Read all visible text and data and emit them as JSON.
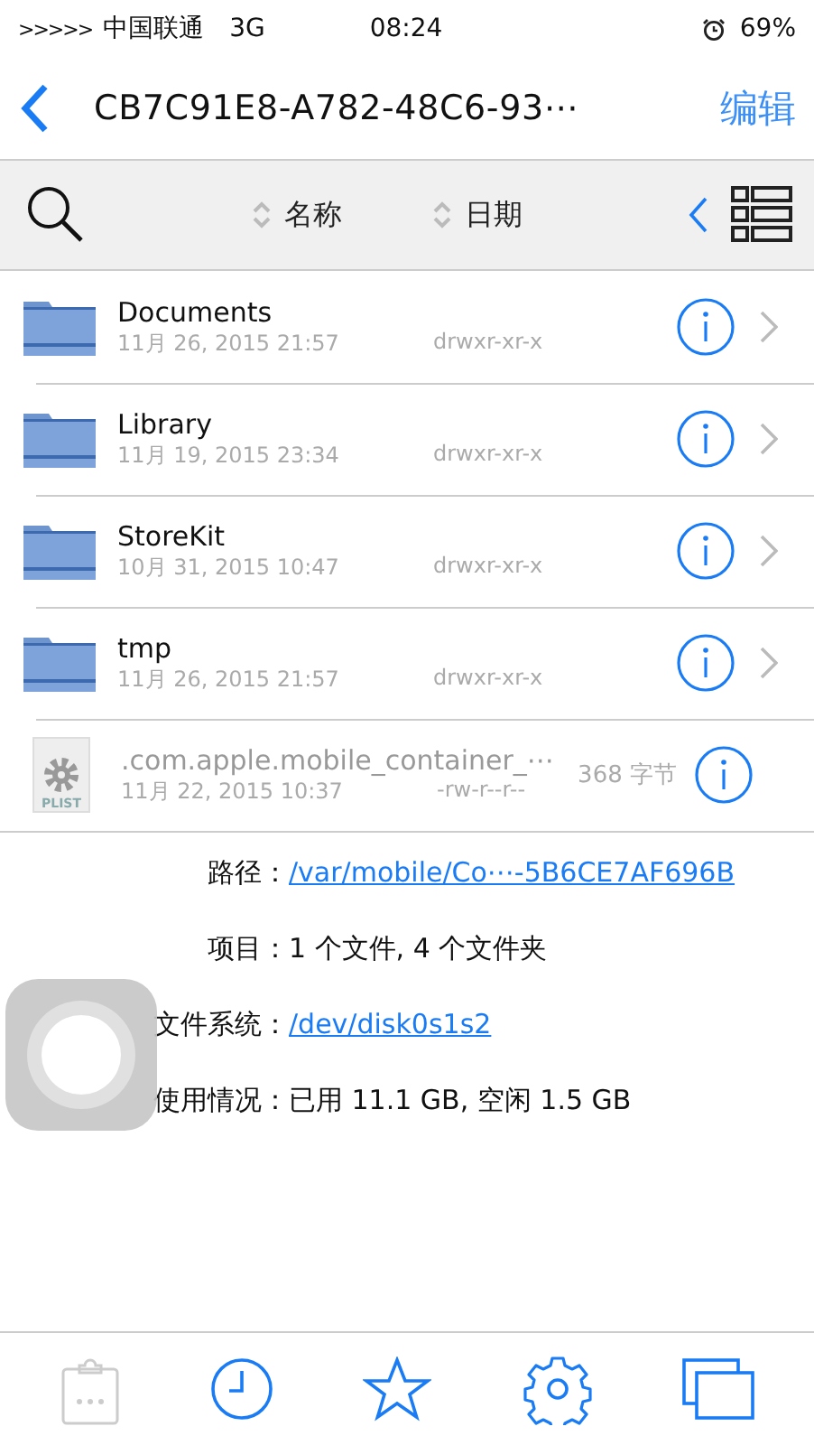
{
  "status_bar": {
    "signal": ">>>>>",
    "carrier": "中国联通",
    "network": "3G",
    "time": "08:24",
    "battery": "69%"
  },
  "nav": {
    "title": "CB7C91E8-A782-48C6-93⋯",
    "edit": "编辑"
  },
  "toolbar": {
    "sort": [
      {
        "label": "名称",
        "selected": false
      },
      {
        "label": "日期",
        "selected": false
      }
    ]
  },
  "files": [
    {
      "kind": "folder",
      "name": "Documents",
      "date": "11月 26, 2015 21:57",
      "perms": "drwxr-xr-x"
    },
    {
      "kind": "folder",
      "name": "Library",
      "date": "11月 19, 2015 23:34",
      "perms": "drwxr-xr-x"
    },
    {
      "kind": "folder",
      "name": "StoreKit",
      "date": "10月 31, 2015 10:47",
      "perms": "drwxr-xr-x"
    },
    {
      "kind": "folder",
      "name": "tmp",
      "date": "11月 26, 2015 21:57",
      "perms": "drwxr-xr-x"
    },
    {
      "kind": "plist",
      "name": ".com.apple.mobile_container_⋯",
      "date": "11月 22, 2015 10:37",
      "perms": "-rw-r--r--",
      "size": "368 字节",
      "badge": "PLIST"
    }
  ],
  "info": [
    {
      "kind": "link",
      "label": "路径：",
      "value": "/var/mobile/Co⋯-5B6CE7AF696B"
    },
    {
      "kind": "text",
      "label": "项目：",
      "value": "1 个文件, 4 个文件夹"
    },
    {
      "kind": "link",
      "label": "文件系统：",
      "value": "/dev/disk0s1s2"
    },
    {
      "kind": "text",
      "label": "使用情况：",
      "value": "已用 11.1 GB, 空闲 1.5 GB"
    }
  ],
  "tab_bar": [
    {
      "kind": "clipboard",
      "disabled": true
    },
    {
      "kind": "clock",
      "disabled": false
    },
    {
      "kind": "star",
      "disabled": false
    },
    {
      "kind": "gear",
      "disabled": false
    },
    {
      "kind": "windows",
      "disabled": false
    }
  ]
}
